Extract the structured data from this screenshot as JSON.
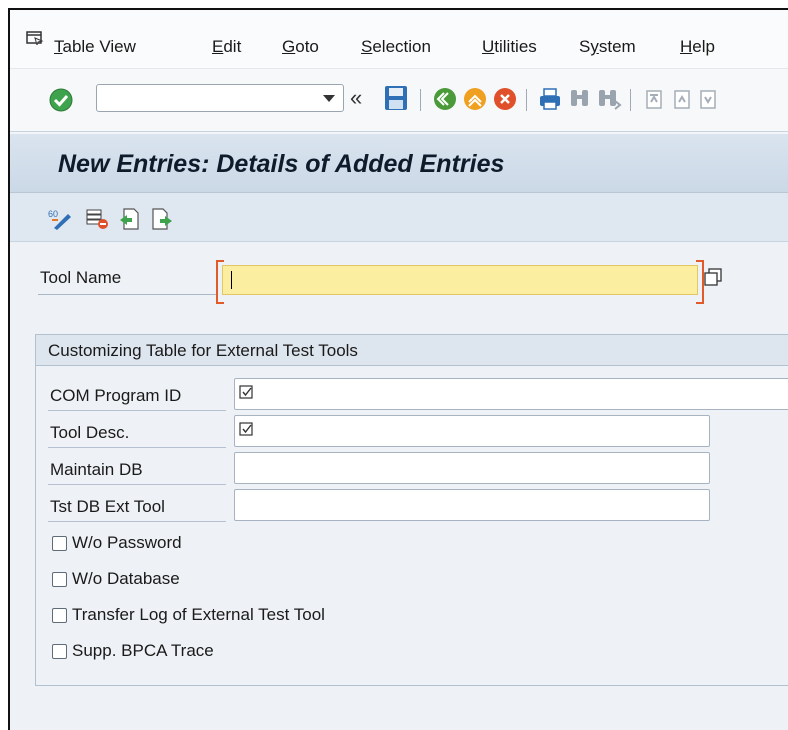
{
  "menubar": {
    "items": [
      {
        "pre": "",
        "ul": "T",
        "post": "able View"
      },
      {
        "pre": "",
        "ul": "E",
        "post": "dit"
      },
      {
        "pre": "",
        "ul": "G",
        "post": "oto"
      },
      {
        "pre": "",
        "ul": "S",
        "post": "election"
      },
      {
        "pre": "",
        "ul": "U",
        "post": "tilities"
      },
      {
        "pre": "S",
        "ul": "y",
        "post": "stem"
      },
      {
        "pre": "",
        "ul": "H",
        "post": "elp"
      }
    ]
  },
  "toolbar": {
    "command_value": "",
    "back_glyph": "«"
  },
  "screen": {
    "title": "New Entries: Details of Added Entries"
  },
  "form": {
    "tool_name_label": "Tool Name",
    "tool_name_value": "",
    "group_title": "Customizing Table for External Test Tools",
    "fields": [
      {
        "label": "COM Program ID",
        "checked_mark": true
      },
      {
        "label": "Tool Desc.",
        "checked_mark": true
      },
      {
        "label": "Maintain DB",
        "checked_mark": false
      },
      {
        "label": "Tst DB Ext Tool",
        "checked_mark": false
      }
    ],
    "checkboxes": [
      {
        "label": "W/o Password",
        "checked": false
      },
      {
        "label": "W/o Database",
        "checked": false
      },
      {
        "label": "Transfer Log of External Test Tool",
        "checked": false
      },
      {
        "label": "Supp. BPCA Trace",
        "checked": false
      }
    ]
  },
  "colors": {
    "required_field": "#fbeea1",
    "required_marker": "#e05a2a",
    "header_band": "#d9e4ef"
  }
}
